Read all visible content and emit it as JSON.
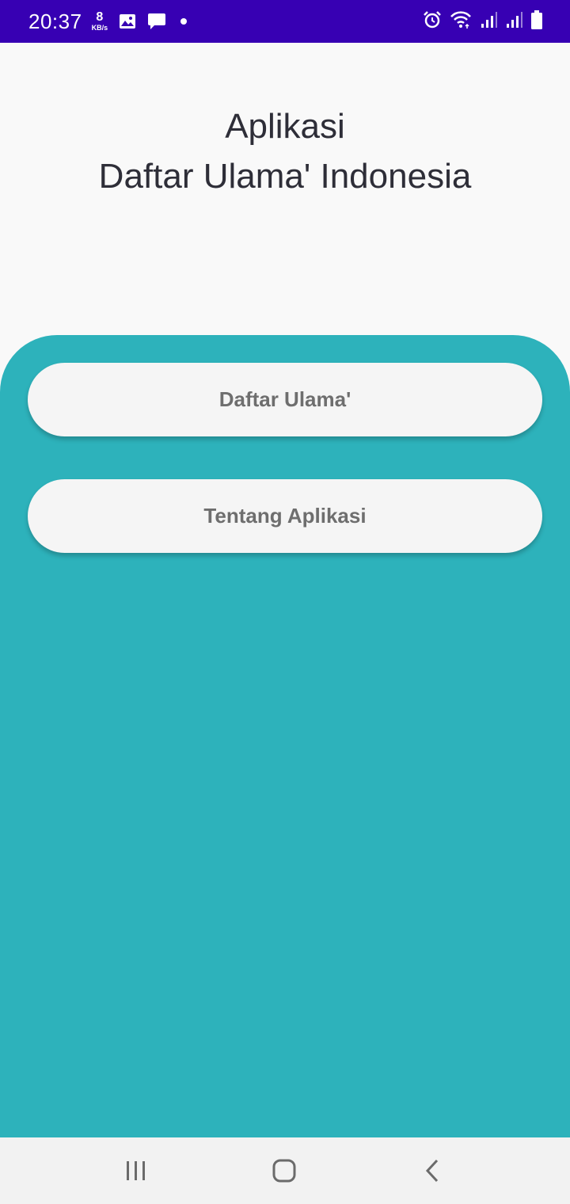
{
  "status_bar": {
    "time": "20:37",
    "net_speed_value": "8",
    "net_speed_unit": "KB/s",
    "left_icons": [
      "image-icon",
      "message-icon",
      "dot-indicator"
    ],
    "right_icons": [
      "alarm-icon",
      "wifi-icon",
      "signal-icon",
      "signal-icon",
      "battery-icon"
    ]
  },
  "header": {
    "title_line1": "Aplikasi",
    "title_line2": "Daftar Ulama' Indonesia"
  },
  "menu": {
    "daftar_label": "Daftar Ulama'",
    "tentang_label": "Tentang Aplikasi"
  },
  "nav_bar": {
    "icons": [
      "recent-apps-icon",
      "home-icon",
      "back-icon"
    ]
  },
  "colors": {
    "status_bar": "#3700b3",
    "background": "#f9f9f9",
    "panel": "#2db2bb",
    "button": "#f5f5f5",
    "button_text": "#6e6e6e",
    "title_text": "#2e2e38",
    "nav_bar": "#f2f2f2"
  }
}
